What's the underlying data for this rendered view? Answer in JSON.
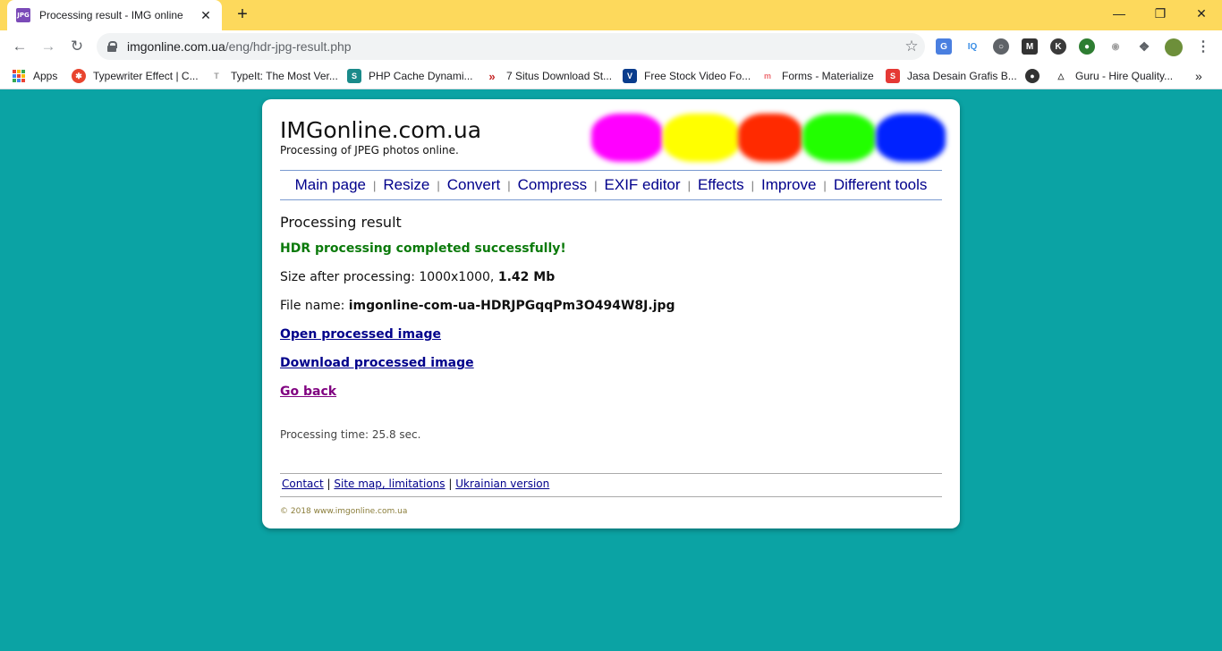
{
  "browser": {
    "tab_title": "Processing result - IMG online",
    "tab_favicon_text": "JPG",
    "url_host": "imgonline.com.ua",
    "url_path": "/eng/hdr-jpg-result.php",
    "bookmarks": [
      {
        "label": "Apps",
        "icon": "apps-grid-icon"
      },
      {
        "label": "Typewriter Effect | C...",
        "icon": "typewriter-icon",
        "color": "#e8452f"
      },
      {
        "label": "TypeIt: The Most Ver...",
        "icon": "typeit-icon",
        "color": "#999999"
      },
      {
        "label": "PHP Cache Dynami...",
        "icon": "php-cache-icon",
        "color": "#1a8a8a"
      },
      {
        "label": "7 Situs Download St...",
        "icon": "chevron-red-icon",
        "color": "#c62828"
      },
      {
        "label": "Free Stock Video Fo...",
        "icon": "v-logo-icon",
        "color": "#0a3c8c"
      },
      {
        "label": "Forms - Materialize",
        "icon": "materialize-icon",
        "color": "#ee6e73"
      },
      {
        "label": "Jasa Desain Grafis B...",
        "icon": "s-logo-icon",
        "color": "#e53935"
      },
      {
        "label": "",
        "icon": "globe-icon",
        "color": "#333333"
      },
      {
        "label": "Guru - Hire Quality...",
        "icon": "guru-icon",
        "color": "#444444"
      }
    ]
  },
  "page": {
    "site_title": "IMGonline.com.ua",
    "site_subtitle": "Processing of JPEG photos online.",
    "nav": [
      "Main page",
      "Resize",
      "Convert",
      "Compress",
      "EXIF editor",
      "Effects",
      "Improve",
      "Different tools"
    ],
    "nav_separator": "|",
    "heading": "Processing result",
    "success_message": "HDR processing completed successfully!",
    "size_label": "Size after processing:",
    "size_dims": "1000x1000,",
    "size_value": "1.42 Mb",
    "file_label": "File name:",
    "file_name": "imgonline-com-ua-HDRJPGqqPm3O494W8J.jpg",
    "link_open": "Open processed image",
    "link_download": "Download processed image",
    "link_back": "Go back",
    "processing_time": "Processing time: 25.8 sec.",
    "footer_links": [
      "Contact",
      "Site map, limitations",
      "Ukrainian version"
    ],
    "footer_separator": "|",
    "copyright": "© 2018 www.imgonline.com.ua",
    "blob_colors": [
      "#ff00ff",
      "#ffff00",
      "#ff2a00",
      "#22ff00",
      "#0022ff"
    ]
  },
  "colors": {
    "page_bg": "#0ba3a4",
    "titlebar_bg": "#fdd95c",
    "link": "#00008b",
    "visited_link": "#800080",
    "success": "#0b7a0b"
  }
}
